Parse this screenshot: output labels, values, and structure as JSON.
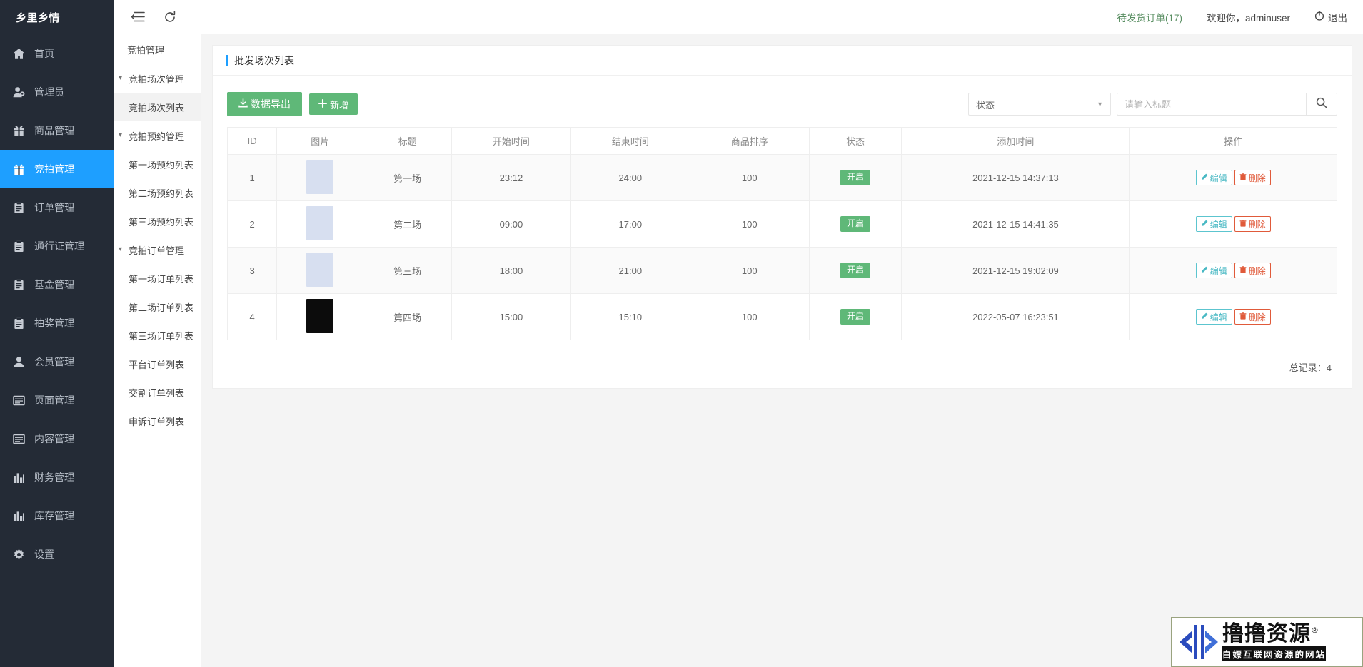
{
  "brand": {
    "name": "乡里乡情"
  },
  "topbar": {
    "menu_icon": "hamburger-collapse-icon",
    "refresh_icon": "refresh-icon",
    "pending_orders": "待发货订单(17)",
    "welcome": "欢迎你，adminuser",
    "logout": "退出",
    "power_icon": "power-icon"
  },
  "sidebar": {
    "items": [
      {
        "label": "首页",
        "icon": "home-icon",
        "active": false
      },
      {
        "label": "管理员",
        "icon": "user-gear-icon",
        "active": false
      },
      {
        "label": "商品管理",
        "icon": "gift-icon",
        "active": false
      },
      {
        "label": "竞拍管理",
        "icon": "gift-icon",
        "active": true
      },
      {
        "label": "订单管理",
        "icon": "clipboard-icon",
        "active": false
      },
      {
        "label": "通行证管理",
        "icon": "clipboard-icon",
        "active": false
      },
      {
        "label": "基金管理",
        "icon": "clipboard-icon",
        "active": false
      },
      {
        "label": "抽奖管理",
        "icon": "clipboard-icon",
        "active": false
      },
      {
        "label": "会员管理",
        "icon": "person-icon",
        "active": false
      },
      {
        "label": "页面管理",
        "icon": "window-icon",
        "active": false
      },
      {
        "label": "内容管理",
        "icon": "window-icon",
        "active": false
      },
      {
        "label": "财务管理",
        "icon": "chart-icon",
        "active": false
      },
      {
        "label": "库存管理",
        "icon": "chart-icon",
        "active": false
      },
      {
        "label": "设置",
        "icon": "gear-icon",
        "active": false
      }
    ]
  },
  "subnav": {
    "title": "竞拍管理",
    "entries": [
      {
        "label": "竞拍场次管理",
        "type": "group",
        "active": false
      },
      {
        "label": "竞拍场次列表",
        "type": "item",
        "active": true
      },
      {
        "label": "竞拍预约管理",
        "type": "group",
        "active": false
      },
      {
        "label": "第一场预约列表",
        "type": "item",
        "active": false
      },
      {
        "label": "第二场预约列表",
        "type": "item",
        "active": false
      },
      {
        "label": "第三场预约列表",
        "type": "item",
        "active": false
      },
      {
        "label": "竞拍订单管理",
        "type": "group",
        "active": false
      },
      {
        "label": "第一场订单列表",
        "type": "item",
        "active": false
      },
      {
        "label": "第二场订单列表",
        "type": "item",
        "active": false
      },
      {
        "label": "第三场订单列表",
        "type": "item",
        "active": false
      },
      {
        "label": "平台订单列表",
        "type": "item",
        "active": false
      },
      {
        "label": "交割订单列表",
        "type": "item",
        "active": false
      },
      {
        "label": "申诉订单列表",
        "type": "item",
        "active": false
      }
    ]
  },
  "panel": {
    "title": "批发场次列表",
    "export_label": "数据导出",
    "export_icon": "download-icon",
    "add_label": "新增",
    "add_icon": "plus-icon",
    "status_filter": {
      "value": "状态",
      "caret_icon": "chevron-down-icon"
    },
    "search": {
      "value": "",
      "placeholder": "请输入标题",
      "icon": "search-icon"
    },
    "columns": [
      "ID",
      "图片",
      "标题",
      "开始时间",
      "结束时间",
      "商品排序",
      "状态",
      "添加时间",
      "操作"
    ],
    "rows": [
      {
        "id": "1",
        "thumb": "#d7dff0",
        "title": "第一场",
        "start": "23:12",
        "end": "24:00",
        "sort": "100",
        "status": "开启",
        "added": "2021-12-15 14:37:13",
        "edit": "编辑",
        "delete": "删除"
      },
      {
        "id": "2",
        "thumb": "#d7dff0",
        "title": "第二场",
        "start": "09:00",
        "end": "17:00",
        "sort": "100",
        "status": "开启",
        "added": "2021-12-15 14:41:35",
        "edit": "编辑",
        "delete": "删除"
      },
      {
        "id": "3",
        "thumb": "#d7dff0",
        "title": "第三场",
        "start": "18:00",
        "end": "21:00",
        "sort": "100",
        "status": "开启",
        "added": "2021-12-15 19:02:09",
        "edit": "编辑",
        "delete": "删除"
      },
      {
        "id": "4",
        "thumb": "#0c0c0c",
        "title": "第四场",
        "start": "15:00",
        "end": "15:10",
        "sort": "100",
        "status": "开启",
        "added": "2022-05-07 16:23:51",
        "edit": "编辑",
        "delete": "删除"
      }
    ],
    "total": "总记录：4"
  },
  "watermark": {
    "main": "撸撸资源",
    "reg": "®",
    "sub": "白嫖互联网资源的网站"
  },
  "colors": {
    "accent": "#1e9fff",
    "green": "#5FB878",
    "sidebar_bg": "#242b36",
    "edit": "#49b9c4",
    "delete": "#e05a3a"
  }
}
